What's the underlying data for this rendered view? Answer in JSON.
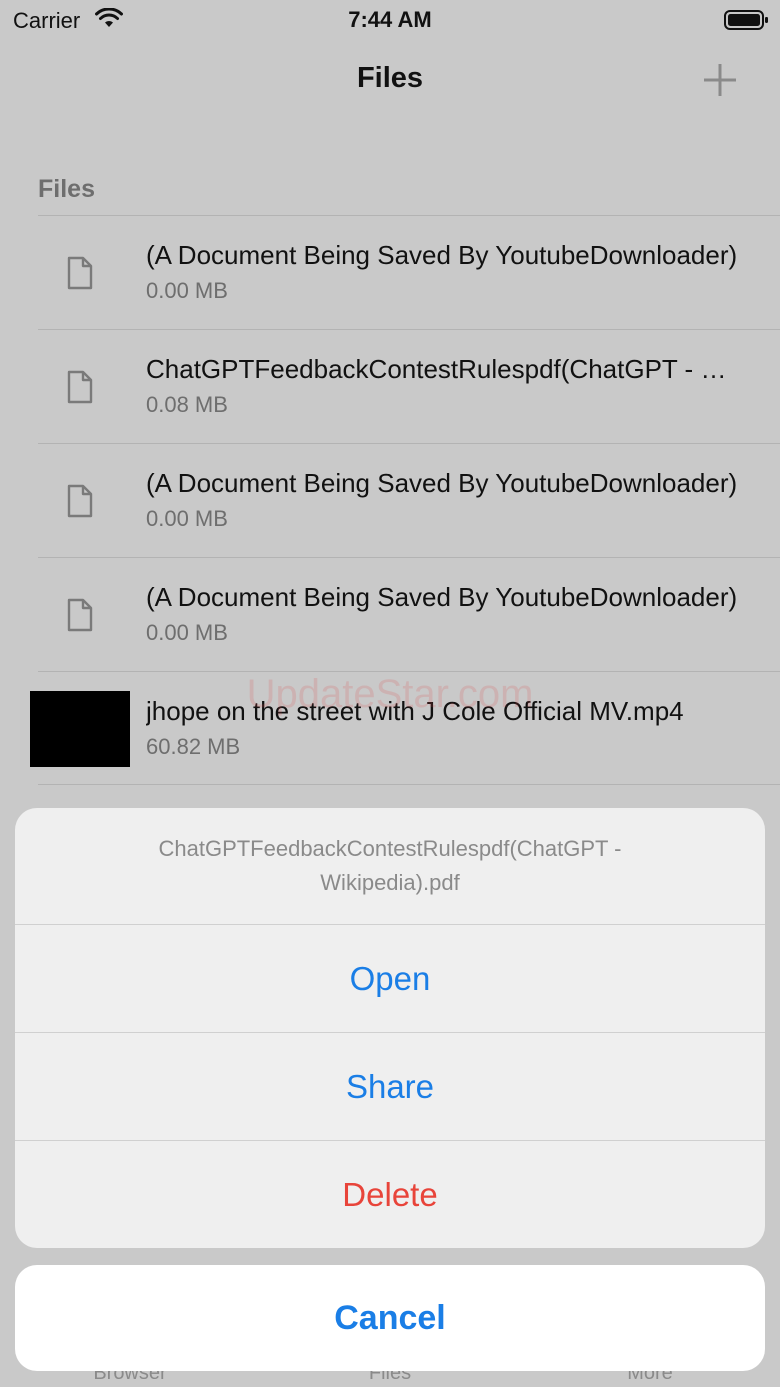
{
  "status_bar": {
    "carrier": "Carrier",
    "time": "7:44 AM"
  },
  "nav": {
    "title": "Files"
  },
  "section": {
    "header": "Files"
  },
  "files": [
    {
      "name": "(A Document Being Saved By YoutubeDownloader)",
      "size": "0.00 MB",
      "kind": "document-icon"
    },
    {
      "name": "ChatGPTFeedbackContestRulespdf(ChatGPT - Wikipedia).pdf",
      "size": "0.08 MB",
      "kind": "document-icon"
    },
    {
      "name": "(A Document Being Saved By YoutubeDownloader)",
      "size": "0.00 MB",
      "kind": "document-icon"
    },
    {
      "name": "(A Document Being Saved By YoutubeDownloader)",
      "size": "0.00 MB",
      "kind": "document-icon"
    },
    {
      "name": "jhope on the street with J Cole Official MV.mp4",
      "size": "60.82 MB",
      "kind": "video-thumbnail"
    }
  ],
  "watermark": "UpdateStar.com",
  "tab_bar": {
    "items": [
      "Browser",
      "Files",
      "More"
    ]
  },
  "action_sheet": {
    "title": "ChatGPTFeedbackContestRulespdf(ChatGPT - Wikipedia).pdf",
    "open_label": "Open",
    "share_label": "Share",
    "delete_label": "Delete",
    "cancel_label": "Cancel"
  },
  "colors": {
    "accent": "#1a7ee6",
    "destructive": "#e8443a",
    "dim_background": "#c9c9c9"
  }
}
